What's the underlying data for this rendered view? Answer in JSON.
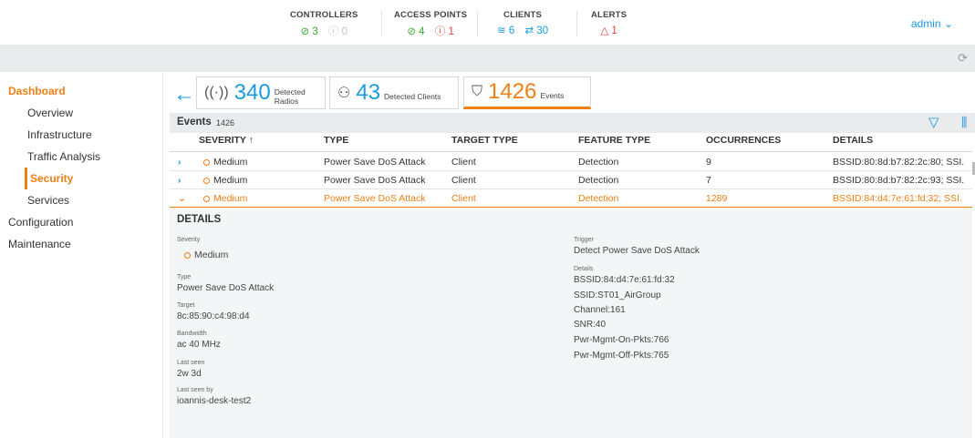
{
  "header": {
    "controllers": {
      "title": "CONTROLLERS",
      "up": "3",
      "down": "0"
    },
    "access_points": {
      "title": "ACCESS POINTS",
      "up": "4",
      "down": "1"
    },
    "clients": {
      "title": "CLIENTS",
      "wireless": "6",
      "wired": "30"
    },
    "alerts": {
      "title": "ALERTS",
      "count": "1"
    },
    "user": "admin"
  },
  "sidebar": {
    "dashboard": "Dashboard",
    "items": [
      "Overview",
      "Infrastructure",
      "Traffic Analysis",
      "Security",
      "Services"
    ],
    "configuration": "Configuration",
    "maintenance": "Maintenance"
  },
  "summary": {
    "radios": {
      "count": "340",
      "label": "Detected Radios"
    },
    "clients": {
      "count": "43",
      "label": "Detected Clients"
    },
    "events": {
      "count": "1426",
      "label": "Events"
    }
  },
  "events": {
    "title": "Events",
    "count": "1426",
    "columns": [
      "SEVERITY",
      "TYPE",
      "TARGET TYPE",
      "FEATURE TYPE",
      "OCCURRENCES",
      "DETAILS"
    ],
    "rows": [
      {
        "severity": "Medium",
        "type": "Power Save DoS Attack",
        "target": "Client",
        "feature": "Detection",
        "occurrences": "9",
        "details": "BSSID:80:8d:b7:82:2c:80; SSI."
      },
      {
        "severity": "Medium",
        "type": "Power Save DoS Attack",
        "target": "Client",
        "feature": "Detection",
        "occurrences": "7",
        "details": "BSSID:80:8d:b7:82:2c:93; SSI."
      },
      {
        "severity": "Medium",
        "type": "Power Save DoS Attack",
        "target": "Client",
        "feature": "Detection",
        "occurrences": "1289",
        "details": "BSSID:84:d4:7e:61:fd:32; SSI."
      }
    ]
  },
  "details": {
    "title": "DETAILS",
    "severity_label": "Severity",
    "severity": "Medium",
    "type_label": "Type",
    "type": "Power Save DoS Attack",
    "target_label": "Target",
    "target": "8c:85:90:c4:98:d4",
    "bandwidth_label": "Bandwidth",
    "bandwidth": "ac 40 MHz",
    "last_seen_label": "Last seen",
    "last_seen": "2w 3d",
    "last_seen_by_label": "Last seen by",
    "last_seen_by": "ioannis-desk-test2",
    "trigger_label": "Trigger",
    "trigger": "Detect Power Save DoS Attack",
    "details_label": "Details",
    "lines": [
      "BSSID:84:d4:7e:61:fd:32",
      "SSID:ST01_AirGroup",
      "Channel:161",
      "SNR:40",
      "Pwr-Mgmt-On-Pkts:766",
      "Pwr-Mgmt-Off-Pkts:765"
    ]
  }
}
